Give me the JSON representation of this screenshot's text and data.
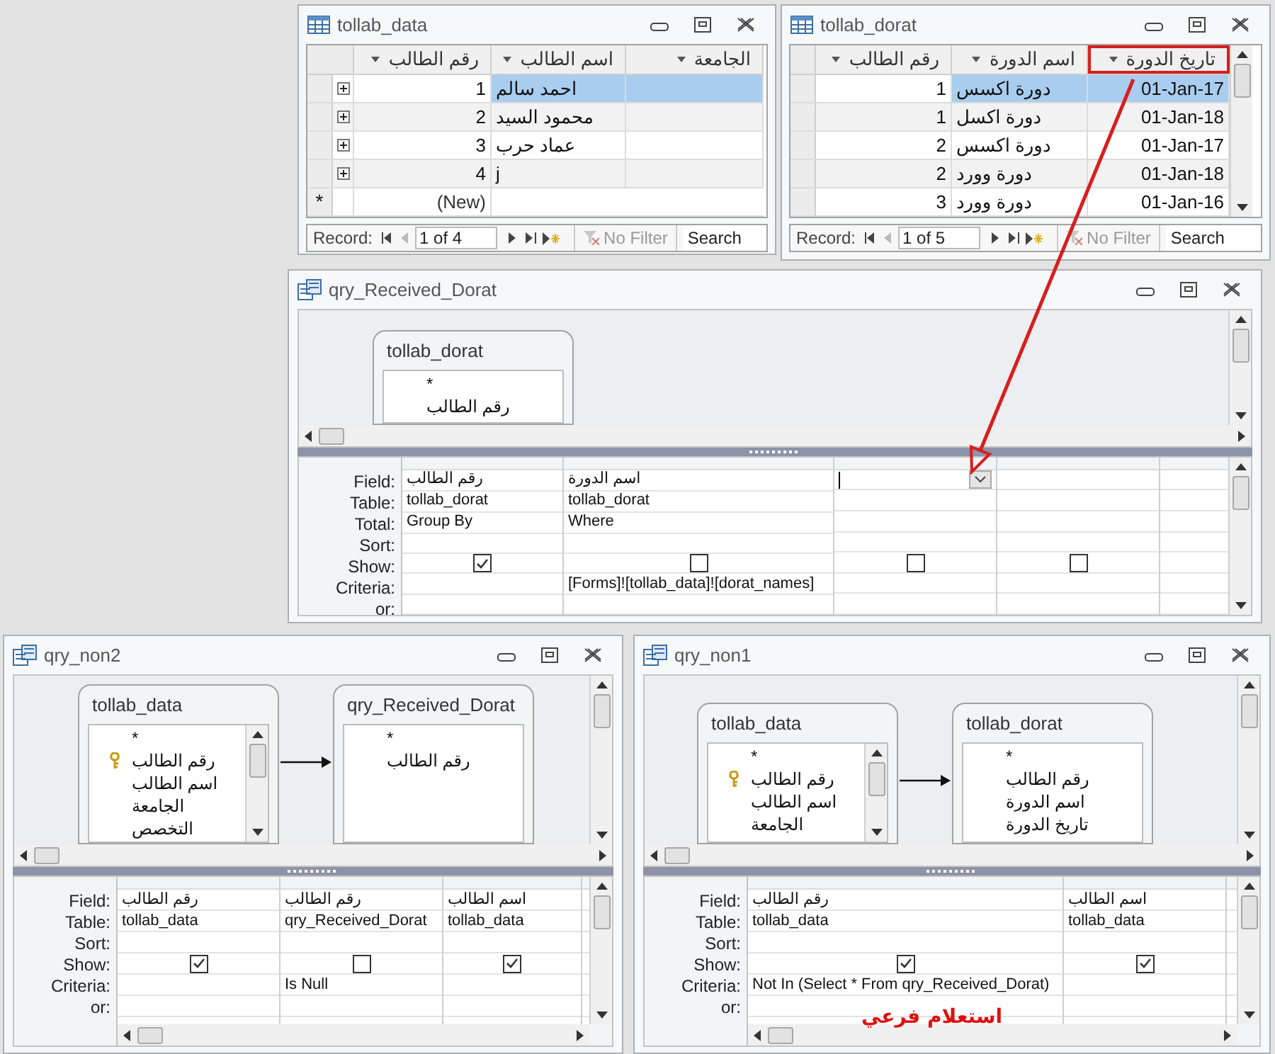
{
  "windows": [
    {
      "kind": "datasheet",
      "title": "tollab_dorat",
      "subdatasheet": false,
      "scrollbar": true,
      "columns": [
        {
          "label": "تاريخ الدورة",
          "kind": "number",
          "highlighted": true
        },
        {
          "label": "اسم الدورة",
          "kind": "text",
          "highlighted": false
        },
        {
          "label": "رقم الطالب",
          "kind": "number",
          "highlighted": false
        }
      ],
      "rows": [
        {
          "cells": [
            {
              "text": "01-Jan-17",
              "selected": true
            },
            {
              "text": "دورة اكسس",
              "selected": true
            },
            {
              "text": "1",
              "selected": false
            }
          ]
        },
        {
          "cells": [
            {
              "text": "01-Jan-18",
              "selected": false
            },
            {
              "text": "دورة اكسل",
              "selected": false
            },
            {
              "text": "1",
              "selected": false
            }
          ]
        },
        {
          "cells": [
            {
              "text": "01-Jan-17",
              "selected": false
            },
            {
              "text": "دورة اكسس",
              "selected": false
            },
            {
              "text": "2",
              "selected": false
            }
          ]
        },
        {
          "cells": [
            {
              "text": "01-Jan-18",
              "selected": false
            },
            {
              "text": "دورة وورد",
              "selected": false
            },
            {
              "text": "2",
              "selected": false
            }
          ]
        },
        {
          "cells": [
            {
              "text": "01-Jan-16",
              "selected": false
            },
            {
              "text": "دورة وورد",
              "selected": false
            },
            {
              "text": "3",
              "selected": false
            }
          ]
        }
      ],
      "nav": {
        "label": "Record:",
        "position": "1 of 5",
        "filter": "No Filter",
        "search": "Search"
      }
    },
    {
      "kind": "datasheet",
      "title": "tollab_data",
      "subdatasheet": true,
      "scrollbar": false,
      "columns": [
        {
          "label": "الجامعة",
          "kind": "text",
          "highlighted": false
        },
        {
          "label": "اسم الطالب",
          "kind": "text",
          "highlighted": false
        },
        {
          "label": "رقم الطالب",
          "kind": "number",
          "highlighted": false
        }
      ],
      "rows": [
        {
          "cells": [
            {
              "selected": true
            },
            {
              "text": "احمد سالم",
              "selected": true
            },
            {
              "text": "1",
              "selected": false
            }
          ]
        },
        {
          "cells": [
            {
              "selected": false
            },
            {
              "text": "محمود السيد",
              "selected": false
            },
            {
              "text": "2",
              "selected": false
            }
          ]
        },
        {
          "cells": [
            {
              "selected": false
            },
            {
              "text": "عماد حرب",
              "selected": false
            },
            {
              "text": "3",
              "selected": false
            }
          ]
        },
        {
          "cells": [
            {
              "selected": false
            },
            {
              "text": "j",
              "selected": false
            },
            {
              "text": "4",
              "selected": false
            }
          ]
        }
      ],
      "new_row": {
        "marker": "*",
        "text": "(New)"
      },
      "nav": {
        "label": "Record:",
        "position": "1 of 4",
        "filter": "No Filter",
        "search": "Search"
      }
    },
    {
      "kind": "query",
      "title": "qry_Received_Dorat",
      "tables": [
        {
          "name": "tollab_dorat",
          "scrollbar": false,
          "fields": [
            {
              "name": "*",
              "key": false
            },
            {
              "name": "رقم الطالب",
              "key": false
            }
          ]
        }
      ],
      "grid_rows": [
        {
          "kind": "field",
          "label": "Field:"
        },
        {
          "kind": "table",
          "label": "Table:"
        },
        {
          "kind": "total",
          "label": "Total:"
        },
        {
          "kind": "sort",
          "label": "Sort:"
        },
        {
          "kind": "show",
          "label": "Show:"
        },
        {
          "kind": "criteria",
          "label": "Criteria:"
        },
        {
          "kind": "or",
          "label": "or:"
        }
      ],
      "columns": [
        {
          "show": false,
          "focused": false
        },
        {
          "show": false,
          "focused": true
        },
        {
          "field": "اسم الدورة",
          "table": "tollab_dorat",
          "total": "Where",
          "show": false,
          "criteria": "[Forms]![tollab_data]![dorat_names]",
          "focused": false
        },
        {
          "field": "رقم الطالب",
          "table": "tollab_dorat",
          "total": "Group By",
          "show": true,
          "focused": false
        }
      ]
    },
    {
      "kind": "query",
      "title": "qry_non1",
      "tables": [
        {
          "name": "tollab_dorat",
          "joined": true,
          "scrollbar": false,
          "fields": [
            {
              "name": "*",
              "key": false
            },
            {
              "name": "رقم الطالب",
              "key": false
            },
            {
              "name": "اسم الدورة",
              "key": false
            },
            {
              "name": "تاريخ الدورة",
              "key": false
            }
          ]
        },
        {
          "name": "tollab_data",
          "joined": false,
          "scrollbar": true,
          "fields": [
            {
              "name": "*",
              "key": false
            },
            {
              "name": "رقم الطالب",
              "key": true
            },
            {
              "name": "اسم الطالب",
              "key": false
            },
            {
              "name": "الجامعة",
              "key": false
            }
          ]
        }
      ],
      "grid_rows": [
        {
          "kind": "field",
          "label": "Field:"
        },
        {
          "kind": "table",
          "label": "Table:"
        },
        {
          "kind": "sort",
          "label": "Sort:"
        },
        {
          "kind": "show",
          "label": "Show:"
        },
        {
          "kind": "criteria",
          "label": "Criteria:"
        },
        {
          "kind": "or",
          "label": "or:"
        }
      ],
      "columns": [
        {
          "field": "اسم الطالب",
          "table": "tollab_data",
          "show": true,
          "focused": false
        },
        {
          "field": "رقم الطالب",
          "table": "tollab_data",
          "show": true,
          "criteria": "Not In (Select * From qry_Received_Dorat)",
          "focused": false
        }
      ],
      "annotation": "استعلام فرعي"
    },
    {
      "kind": "query",
      "title": "qry_non2",
      "tables": [
        {
          "name": "qry_Received_Dorat",
          "joined": true,
          "scrollbar": false,
          "fields": [
            {
              "name": "*",
              "key": false
            },
            {
              "name": "رقم الطالب",
              "key": false
            }
          ]
        },
        {
          "name": "tollab_data",
          "joined": false,
          "scrollbar": true,
          "fields": [
            {
              "name": "*",
              "key": false
            },
            {
              "name": "رقم الطالب",
              "key": true
            },
            {
              "name": "اسم الطالب",
              "key": false
            },
            {
              "name": "الجامعة",
              "key": false
            },
            {
              "name": "التخصص",
              "key": false
            }
          ]
        }
      ],
      "grid_rows": [
        {
          "kind": "field",
          "label": "Field:"
        },
        {
          "kind": "table",
          "label": "Table:"
        },
        {
          "kind": "sort",
          "label": "Sort:"
        },
        {
          "kind": "show",
          "label": "Show:"
        },
        {
          "kind": "criteria",
          "label": "Criteria:"
        },
        {
          "kind": "or",
          "label": "or:"
        }
      ],
      "columns": [
        {
          "field": "اسم الطالب",
          "table": "tollab_data",
          "show": true,
          "focused": false
        },
        {
          "field": "رقم الطالب",
          "table": "qry_Received_Dorat",
          "show": false,
          "criteria": "Is Null",
          "focused": false
        },
        {
          "field": "رقم الطالب",
          "table": "tollab_data",
          "show": true,
          "focused": false
        }
      ]
    }
  ]
}
